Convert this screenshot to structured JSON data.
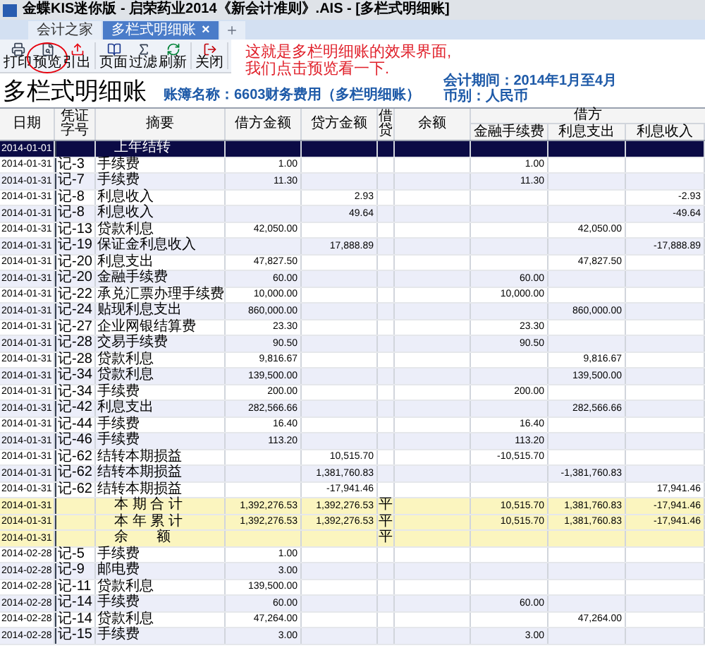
{
  "window": {
    "title": "金蝶KIS迷你版 - 启荣药业2014《新会计准则》.AIS - [多栏式明细账]"
  },
  "tabs": [
    {
      "label": "会计之家",
      "selected": false
    },
    {
      "label": "多栏式明细账",
      "selected": true,
      "close": "×"
    }
  ],
  "toolbar": [
    {
      "kind": "print",
      "label": "打印"
    },
    {
      "kind": "preview",
      "label": "预览",
      "circled": true
    },
    {
      "kind": "export",
      "label": "引出",
      "group_end": true
    },
    {
      "kind": "page",
      "label": "页面"
    },
    {
      "kind": "filter",
      "label": "过滤"
    },
    {
      "kind": "refresh",
      "label": "刷新",
      "group_end": true
    },
    {
      "kind": "close",
      "label": "关闭",
      "group_end": true
    }
  ],
  "annotation": [
    "这就是多栏明细账的效果界面,",
    "我们点击预览看一下."
  ],
  "report": {
    "title": "多栏式明细账",
    "account": "账簿名称：6603财务费用（多栏明细账）",
    "period": "会计期间：2014年1月至4月",
    "currency": "币别：人民币"
  },
  "table": {
    "columns": [
      "日期",
      "凭证字号",
      "摘要",
      "借方金额",
      "贷方金额",
      "借贷",
      "余额"
    ],
    "group": "借方",
    "subcolumns": [
      "金融手续费",
      "利息支出",
      "利息收入"
    ],
    "rows": [
      {
        "kind": "carryover",
        "date": "2014-01-01",
        "summary": "上年结转"
      },
      {
        "kind": "entry",
        "date": "2014-01-31",
        "voucher": "记-3",
        "summary": "手续费",
        "debit": "1.00",
        "fee": "1.00"
      },
      {
        "kind": "entry",
        "date": "2014-01-31",
        "voucher": "记-7",
        "summary": "手续费",
        "debit": "11.30",
        "fee": "11.30"
      },
      {
        "kind": "entry",
        "date": "2014-01-31",
        "voucher": "记-8",
        "summary": "利息收入",
        "credit": "2.93",
        "income": "-2.93"
      },
      {
        "kind": "entry",
        "date": "2014-01-31",
        "voucher": "记-8",
        "summary": "利息收入",
        "credit": "49.64",
        "income": "-49.64"
      },
      {
        "kind": "entry",
        "date": "2014-01-31",
        "voucher": "记-13",
        "summary": "贷款利息",
        "debit": "42,050.00",
        "expense": "42,050.00"
      },
      {
        "kind": "entry",
        "date": "2014-01-31",
        "voucher": "记-19",
        "summary": "保证金利息收入",
        "credit": "17,888.89",
        "income": "-17,888.89"
      },
      {
        "kind": "entry",
        "date": "2014-01-31",
        "voucher": "记-20",
        "summary": "利息支出",
        "debit": "47,827.50",
        "expense": "47,827.50"
      },
      {
        "kind": "entry",
        "date": "2014-01-31",
        "voucher": "记-20",
        "summary": "金融手续费",
        "debit": "60.00",
        "fee": "60.00"
      },
      {
        "kind": "entry",
        "date": "2014-01-31",
        "voucher": "记-22",
        "summary": "承兑汇票办理手续费",
        "debit": "10,000.00",
        "fee": "10,000.00"
      },
      {
        "kind": "entry",
        "date": "2014-01-31",
        "voucher": "记-24",
        "summary": "贴现利息支出",
        "debit": "860,000.00",
        "expense": "860,000.00"
      },
      {
        "kind": "entry",
        "date": "2014-01-31",
        "voucher": "记-27",
        "summary": "企业网银结算费",
        "debit": "23.30",
        "fee": "23.30"
      },
      {
        "kind": "entry",
        "date": "2014-01-31",
        "voucher": "记-28",
        "summary": "交易手续费",
        "debit": "90.50",
        "fee": "90.50"
      },
      {
        "kind": "entry",
        "date": "2014-01-31",
        "voucher": "记-28",
        "summary": "贷款利息",
        "debit": "9,816.67",
        "expense": "9,816.67"
      },
      {
        "kind": "entry",
        "date": "2014-01-31",
        "voucher": "记-34",
        "summary": "贷款利息",
        "debit": "139,500.00",
        "expense": "139,500.00"
      },
      {
        "kind": "entry",
        "date": "2014-01-31",
        "voucher": "记-34",
        "summary": "手续费",
        "debit": "200.00",
        "fee": "200.00"
      },
      {
        "kind": "entry",
        "date": "2014-01-31",
        "voucher": "记-42",
        "summary": "利息支出",
        "debit": "282,566.66",
        "expense": "282,566.66"
      },
      {
        "kind": "entry",
        "date": "2014-01-31",
        "voucher": "记-44",
        "summary": "手续费",
        "debit": "16.40",
        "fee": "16.40"
      },
      {
        "kind": "entry",
        "date": "2014-01-31",
        "voucher": "记-46",
        "summary": "手续费",
        "debit": "113.20",
        "fee": "113.20"
      },
      {
        "kind": "entry",
        "date": "2014-01-31",
        "voucher": "记-62",
        "summary": "结转本期损益",
        "credit": "10,515.70",
        "fee": "-10,515.70"
      },
      {
        "kind": "entry",
        "date": "2014-01-31",
        "voucher": "记-62",
        "summary": "结转本期损益",
        "credit": "1,381,760.83",
        "expense": "-1,381,760.83"
      },
      {
        "kind": "entry",
        "date": "2014-01-31",
        "voucher": "记-62",
        "summary": "结转本期损益",
        "credit": "-17,941.46",
        "income": "17,941.46"
      },
      {
        "kind": "total",
        "date": "2014-01-31",
        "summary": "本 期 合 计",
        "debit": "1,392,276.53",
        "credit": "1,392,276.53",
        "dc": "平",
        "fee": "10,515.70",
        "expense": "1,381,760.83",
        "income": "-17,941.46"
      },
      {
        "kind": "total",
        "date": "2014-01-31",
        "summary": "本 年 累 计",
        "debit": "1,392,276.53",
        "credit": "1,392,276.53",
        "dc": "平",
        "fee": "10,515.70",
        "expense": "1,381,760.83",
        "income": "-17,941.46"
      },
      {
        "kind": "total",
        "date": "2014-01-31",
        "summary": "余　　额",
        "dc": "平"
      },
      {
        "kind": "entry",
        "date": "2014-02-28",
        "voucher": "记-5",
        "summary": "手续费",
        "debit": "1.00"
      },
      {
        "kind": "entry",
        "date": "2014-02-28",
        "voucher": "记-9",
        "summary": "邮电费",
        "debit": "3.00"
      },
      {
        "kind": "entry",
        "date": "2014-02-28",
        "voucher": "记-11",
        "summary": "贷款利息",
        "debit": "139,500.00"
      },
      {
        "kind": "entry",
        "date": "2014-02-28",
        "voucher": "记-14",
        "summary": "手续费",
        "debit": "60.00",
        "fee": "60.00"
      },
      {
        "kind": "entry",
        "date": "2014-02-28",
        "voucher": "记-14",
        "summary": "贷款利息",
        "debit": "47,264.00",
        "expense": "47,264.00"
      },
      {
        "kind": "entry",
        "date": "2014-02-28",
        "voucher": "记-15",
        "summary": "手续费",
        "debit": "3.00",
        "fee": "3.00"
      }
    ]
  }
}
